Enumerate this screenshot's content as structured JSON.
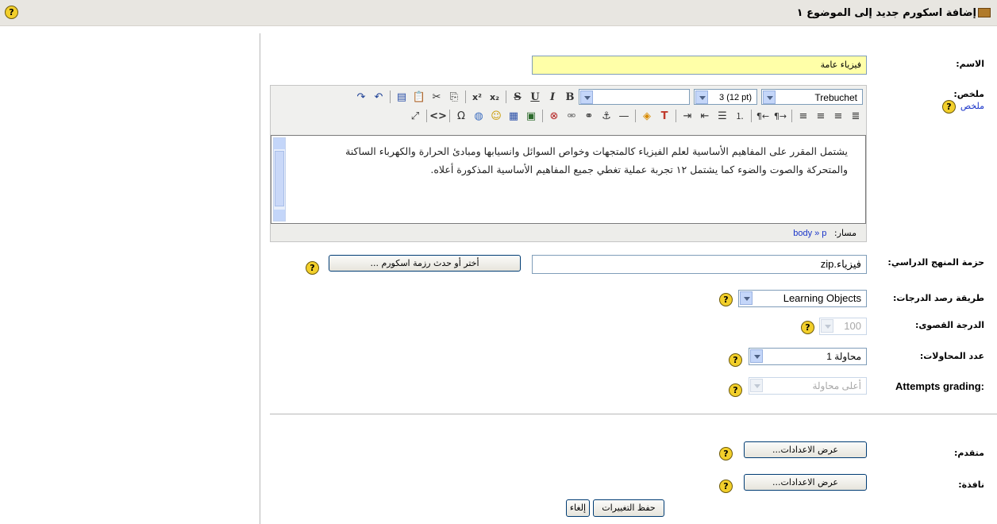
{
  "title_bar": {
    "title": "إضافة اسكورم جديد إلى الموضوع ١",
    "help_glyph": "?"
  },
  "form": {
    "name": {
      "label": "الاسم:",
      "value": "فيزياء عامة"
    },
    "summary": {
      "label": "ملخص:",
      "help_link": "ملخص",
      "editor": {
        "font_family": "Trebuchet",
        "font_size": "3 (12 pt)",
        "toolbar_row1": [
          "bold",
          "italic",
          "underline",
          "strikethrough",
          "subscript",
          "superscript",
          "copy",
          "cut",
          "paste",
          "paste-word",
          "undo",
          "redo"
        ],
        "toolbar_row2": [
          "justify-full",
          "align-right",
          "align-center",
          "align-left",
          "ltr",
          "rtl",
          "ordered-list",
          "unordered-list",
          "outdent",
          "indent",
          "text-color",
          "background-color",
          "horizontal-rule",
          "anchor",
          "link",
          "unlink",
          "delete",
          "image",
          "table",
          "smiley",
          "insert-file",
          "insert-char",
          "html-source",
          "fullscreen"
        ],
        "content": "يشتمل المقرر على المفاهيم الأساسية لعلم الفيزياء كالمتجهات وخواص السوائل وانسيابها ومبادئ الحرارة والكهرباء الساكنة والمتحركة والصوت والضوء كما يشتمل ١٢ تجربة عملية تغطي جميع المفاهيم الأساسية المذكورة أعلاه.",
        "path_label": "مسار:",
        "path": "body » p"
      }
    },
    "package": {
      "label": "حزمة المنهج الدراسي:",
      "value": "فيزياء.zip",
      "button": "أختر أو حدث رزمة اسكورم ..."
    },
    "grading_method": {
      "label": "طريقة رصد الدرجات:",
      "value": "Learning Objects"
    },
    "max_grade": {
      "label": "الدرجة القصوى:",
      "value": "100"
    },
    "attempts": {
      "label": "عدد المحاولات:",
      "value": "1 محاولة"
    },
    "attempts_grading": {
      "label": "Attempts grading:",
      "value": "أعلى محاولة"
    },
    "advanced": {
      "label": "متقدم:",
      "button": "عرض الاعدادات..."
    },
    "window": {
      "label": "نافذة:",
      "button": "عرض الاعدادات..."
    },
    "actions": {
      "save": "حفظ التغييرات",
      "cancel": "إلغاء"
    }
  },
  "colors": {
    "highlight_input": "#ffffa8",
    "link": "#1a35c9",
    "help_icon": "#f2cf2b"
  }
}
